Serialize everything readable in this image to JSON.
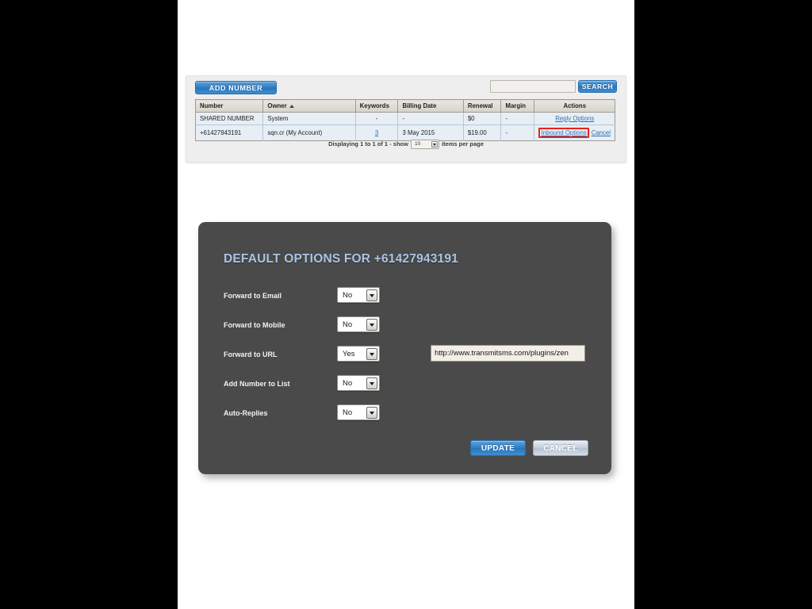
{
  "panel": {
    "add_number_label": "ADD NUMBER",
    "search_button_label": "SEARCH",
    "search_value": "",
    "search_placeholder": ""
  },
  "table": {
    "columns": [
      "Number",
      "Owner",
      "Keywords",
      "Billing Date",
      "Renewal",
      "Margin",
      "Actions"
    ],
    "sorted_column": "Owner",
    "sort_direction": "ascending",
    "rows": [
      {
        "number": "SHARED NUMBER",
        "owner": "System",
        "keywords": "-",
        "billing_date": "-",
        "renewal": "$0",
        "margin": "-",
        "action_primary": "Reply Options",
        "action_secondary": ""
      },
      {
        "number": "+61427943191",
        "owner": "sqn.cr (My Account)",
        "keywords": "3",
        "billing_date": "3 May 2015",
        "renewal": "$19.00",
        "margin": "-",
        "action_primary": "Inbound Options",
        "action_secondary": "Cancel"
      }
    ]
  },
  "pagination": {
    "prefix": "Displaying 1 to 1 of 1 - show",
    "per_page_value": "10",
    "suffix": "items per page"
  },
  "modal": {
    "title": "DEFAULT OPTIONS FOR +61427943191",
    "fields": [
      {
        "label": "Forward to Email",
        "value": "No"
      },
      {
        "label": "Forward to Mobile",
        "value": "No"
      },
      {
        "label": "Forward to URL",
        "value": "Yes"
      },
      {
        "label": "Add Number to List",
        "value": "No"
      },
      {
        "label": "Auto-Replies",
        "value": "No"
      }
    ],
    "url_value": "http://www.transmitsms.com/plugins/zen",
    "update_label": "UPDATE",
    "cancel_label": "CANCEL"
  },
  "colors": {
    "accent_blue": "#2f7dc4",
    "modal_bg": "#4a4a4a",
    "modal_title": "#aac4e4",
    "link": "#2f6fb0",
    "highlight": "#e8221c",
    "row_bg": "#e7eef5"
  }
}
